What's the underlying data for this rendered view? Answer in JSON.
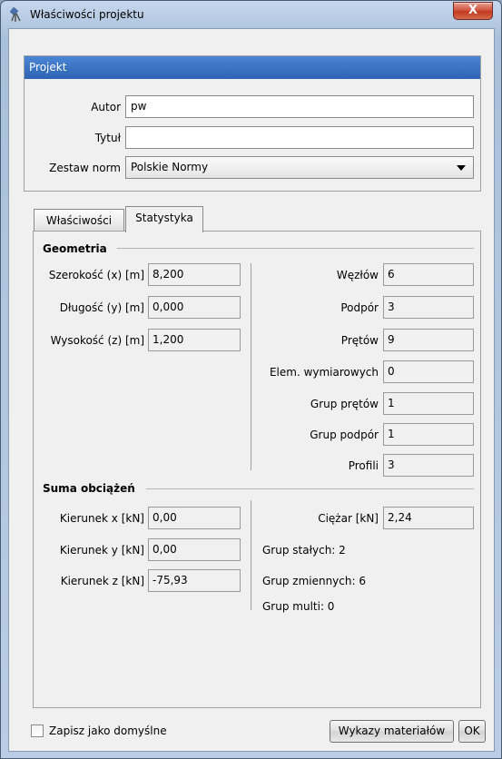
{
  "window": {
    "title": "Właściwości projektu",
    "close_glyph": "X"
  },
  "project": {
    "header": "Projekt",
    "author_label": "Autor",
    "author_value": "pw",
    "title_label": "Tytuł",
    "title_value": "",
    "norms_label": "Zestaw norm",
    "norms_value": "Polskie Normy"
  },
  "tabs": [
    "Właściwości",
    "Statystyka"
  ],
  "geometry": {
    "title": "Geometria",
    "left": [
      {
        "label": "Szerokość (x) [m]",
        "value": "8,200"
      },
      {
        "label": "Długość (y) [m]",
        "value": "0,000"
      },
      {
        "label": "Wysokość (z) [m]",
        "value": "1,200"
      }
    ],
    "right": [
      {
        "label": "Węzłów",
        "value": "6"
      },
      {
        "label": "Podpór",
        "value": "3"
      },
      {
        "label": "Prętów",
        "value": "9"
      },
      {
        "label": "Elem. wymiarowych",
        "value": "0"
      },
      {
        "label": "Grup prętów",
        "value": "1"
      },
      {
        "label": "Grup podpór",
        "value": "1"
      },
      {
        "label": "Profili",
        "value": "3"
      }
    ]
  },
  "loads": {
    "title": "Suma obciążeń",
    "left": [
      {
        "label": "Kierunek x [kN]",
        "value": "0,00"
      },
      {
        "label": "Kierunek y [kN]",
        "value": "0,00"
      },
      {
        "label": "Kierunek z [kN]",
        "value": "-75,93"
      }
    ],
    "weight_label": "Ciężar [kN]",
    "weight_value": "2,24",
    "stat_lines": [
      "Grup stałych: 2",
      "Grup zmiennych: 6",
      "Grup multi: 0"
    ]
  },
  "footer": {
    "checkbox_label": "Zapisz jako domyślne",
    "materials_button": "Wykazy materiałów",
    "ok_button": "OK"
  }
}
